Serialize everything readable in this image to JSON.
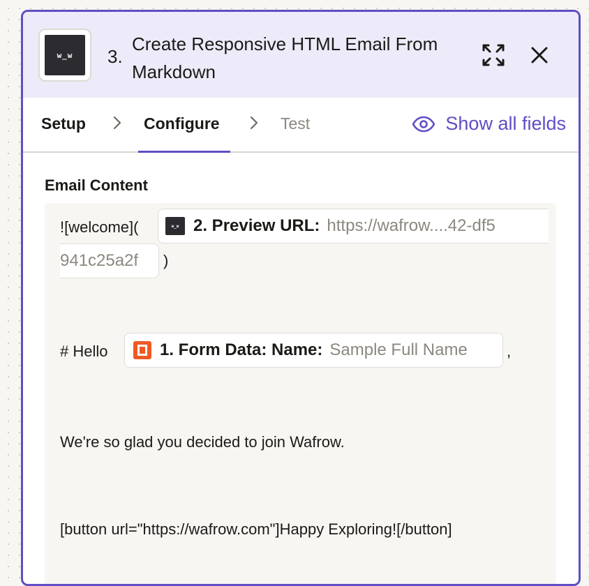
{
  "header": {
    "step_number": "3.",
    "title": "Create Responsive HTML Email From Markdown",
    "app_logo_text": "w_w",
    "expand_icon": "expand-arrows-icon",
    "close_icon": "close-icon"
  },
  "tabs": {
    "setup": "Setup",
    "configure": "Configure",
    "test": "Test",
    "active": "Configure",
    "show_all_fields": "Show all fields"
  },
  "email_content": {
    "label": "Email Content",
    "line1_prefix": "![welcome](",
    "preview_pill": {
      "label": "2. Preview URL:",
      "value": "https://wafrow....42-df5",
      "value_cont": "941c25a2f"
    },
    "line1_suffix": ")",
    "hello_prefix": "# Hello",
    "form_pill": {
      "label": "1. Form Data: Name:",
      "value": "Sample Full Name"
    },
    "hello_suffix": ",",
    "glad_line": "We're so glad you decided to join Wafrow.",
    "button_line": "[button url=\"https://wafrow.com\"]Happy Exploring![/button]"
  },
  "colors": {
    "accent": "#5f4ec4",
    "header_bg": "#edebf9",
    "form_icon": "#ee5a24"
  }
}
